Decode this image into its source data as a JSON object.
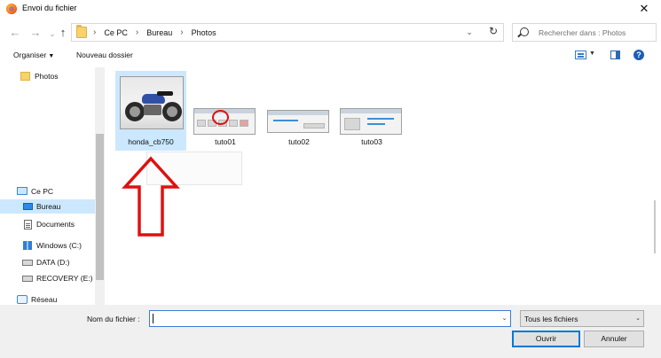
{
  "window": {
    "title": "Envoi du fichier",
    "close_glyph": "✕"
  },
  "address": {
    "crumbs": [
      "Ce PC",
      "Bureau",
      "Photos"
    ],
    "separator": "›",
    "search_placeholder": "Rechercher dans : Photos"
  },
  "nav": {
    "back": "←",
    "forward": "→",
    "up": "↑",
    "dropdown": "⌄",
    "refresh": "↻"
  },
  "toolbar": {
    "organize_label": "Organiser",
    "new_folder_label": "Nouveau dossier",
    "help_label": "?"
  },
  "sidebar": {
    "items": [
      {
        "label": "Photos",
        "icon": "folder-icon"
      },
      {
        "label": "Ce PC",
        "icon": "computer-icon"
      },
      {
        "label": "Bureau",
        "icon": "desktop-icon",
        "selected": true
      },
      {
        "label": "Documents",
        "icon": "document-icon"
      },
      {
        "label": "Windows (C:)",
        "icon": "windows-drive-icon"
      },
      {
        "label": "DATA (D:)",
        "icon": "drive-icon"
      },
      {
        "label": "RECOVERY (E:)",
        "icon": "drive-icon"
      },
      {
        "label": "Réseau",
        "icon": "network-icon"
      }
    ]
  },
  "files": [
    {
      "name": "honda_cb750",
      "kind": "photo",
      "selected": true
    },
    {
      "name": "tuto01",
      "kind": "screenshot"
    },
    {
      "name": "tuto02",
      "kind": "screenshot"
    },
    {
      "name": "tuto03",
      "kind": "screenshot"
    }
  ],
  "footer": {
    "filename_label": "Nom du fichier :",
    "filename_value": "",
    "filetype_value": "Tous les fichiers",
    "open_label": "Ouvrir",
    "cancel_label": "Annuler"
  },
  "annotations": {
    "color": "#e01010"
  }
}
